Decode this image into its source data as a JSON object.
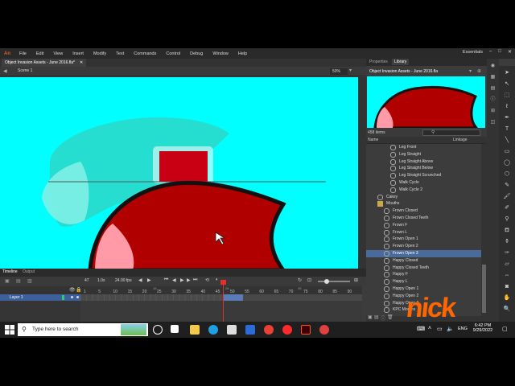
{
  "app": {
    "logo": "An",
    "menu": [
      "File",
      "Edit",
      "View",
      "Insert",
      "Modify",
      "Text",
      "Commands",
      "Control",
      "Debug",
      "Window",
      "Help"
    ],
    "workspace": "Essentials",
    "window_controls": [
      "–",
      "□",
      "✕"
    ]
  },
  "doc_tab": {
    "title": "Object Invasion Assets - June 2016.fla*",
    "close": "✕"
  },
  "editbar": {
    "scene": "Scene 1",
    "zoom": "50%"
  },
  "timeline": {
    "tabs": [
      "Timeline",
      "Output"
    ],
    "toolbar": {
      "frame": "47",
      "speed": "1.0x",
      "fps": "24.00 fps"
    },
    "ruler_top": [
      "16",
      "26",
      "36"
    ],
    "ruler": [
      "1",
      "5",
      "10",
      "15",
      "20",
      "25",
      "30",
      "35",
      "40",
      "45",
      "50",
      "55",
      "60",
      "65",
      "70",
      "75",
      "80",
      "85",
      "90"
    ],
    "layer": "Layer 1",
    "playhead_frame": 47
  },
  "panels": {
    "tabs": [
      "Properties",
      "Library"
    ],
    "library": {
      "document": "Object Invasion Assets - June 2016.fla",
      "item_count": "458 items",
      "columns": [
        "Name",
        "Linkage"
      ],
      "items": [
        {
          "label": "Leg Front",
          "indent": 3,
          "type": "symbol"
        },
        {
          "label": "Leg Straight",
          "indent": 3,
          "type": "symbol"
        },
        {
          "label": "Leg Straight Above",
          "indent": 3,
          "type": "symbol"
        },
        {
          "label": "Leg Straight Below",
          "indent": 3,
          "type": "symbol"
        },
        {
          "label": "Leg Straight Scrunched",
          "indent": 3,
          "type": "symbol"
        },
        {
          "label": "Walk Cycle",
          "indent": 3,
          "type": "symbol"
        },
        {
          "label": "Walk Cycle 2",
          "indent": 3,
          "type": "symbol"
        },
        {
          "label": "Cakey",
          "indent": 1,
          "type": "symbol"
        },
        {
          "label": "Mouths",
          "indent": 1,
          "type": "folder"
        },
        {
          "label": "Frown Closed",
          "indent": 2,
          "type": "symbol"
        },
        {
          "label": "Frown Closed Teeth",
          "indent": 2,
          "type": "symbol"
        },
        {
          "label": "Frown F",
          "indent": 2,
          "type": "symbol"
        },
        {
          "label": "Frown L",
          "indent": 2,
          "type": "symbol"
        },
        {
          "label": "Frown Open 1",
          "indent": 2,
          "type": "symbol"
        },
        {
          "label": "Frown Open 2",
          "indent": 2,
          "type": "symbol"
        },
        {
          "label": "Frown Open 3",
          "indent": 2,
          "type": "symbol",
          "selected": true
        },
        {
          "label": "Happy Closed",
          "indent": 2,
          "type": "symbol"
        },
        {
          "label": "Happy Closed Teeth",
          "indent": 2,
          "type": "symbol"
        },
        {
          "label": "Happy F",
          "indent": 2,
          "type": "symbol"
        },
        {
          "label": "Happy L",
          "indent": 2,
          "type": "symbol"
        },
        {
          "label": "Happy Open 1",
          "indent": 2,
          "type": "symbol"
        },
        {
          "label": "Happy Open 2",
          "indent": 2,
          "type": "symbol"
        },
        {
          "label": "Happy Open 3",
          "indent": 2,
          "type": "symbol"
        },
        {
          "label": "KPC Mouths",
          "indent": 2,
          "type": "symbol"
        }
      ]
    }
  },
  "taskbar": {
    "search_placeholder": "Type here to search",
    "language": "ENG",
    "time": "6:42 PM",
    "date": "9/29/2022"
  },
  "watermark": "nick",
  "colors": {
    "stage": "#00ffff",
    "mouth_red": "#b00000",
    "selection": "#4a6a9a",
    "nick_orange": "#ff6600"
  }
}
